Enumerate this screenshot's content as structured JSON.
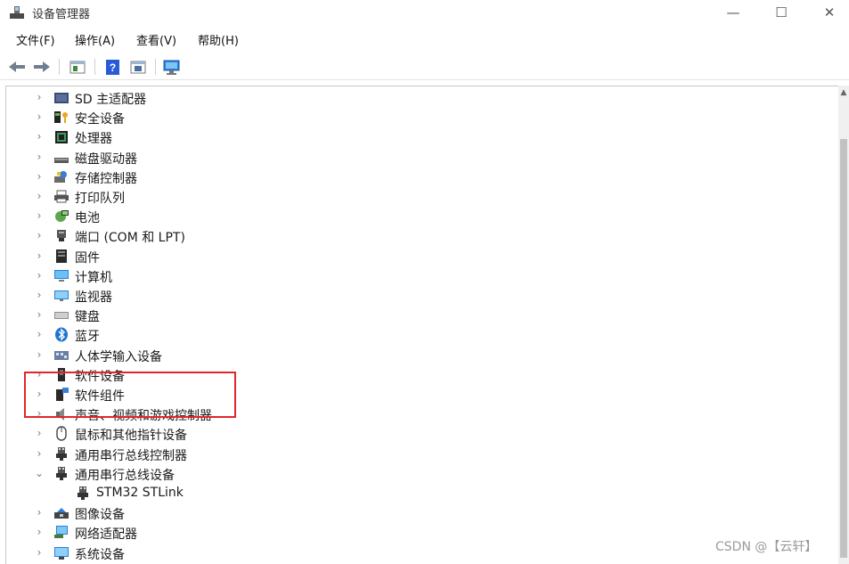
{
  "window": {
    "title": "设备管理器",
    "minimize": "—",
    "maximize": "☐",
    "close": "✕"
  },
  "menu": [
    "文件(F)",
    "操作(A)",
    "查看(V)",
    "帮助(H)"
  ],
  "tree": {
    "items": [
      {
        "label": "SD 主适配器",
        "icon": "sd-card-icon"
      },
      {
        "label": "安全设备",
        "icon": "security-key-icon"
      },
      {
        "label": "处理器",
        "icon": "processor-icon"
      },
      {
        "label": "磁盘驱动器",
        "icon": "disk-drive-icon"
      },
      {
        "label": "存储控制器",
        "icon": "storage-controller-icon"
      },
      {
        "label": "打印队列",
        "icon": "printer-icon"
      },
      {
        "label": "电池",
        "icon": "battery-icon"
      },
      {
        "label": "端口 (COM 和 LPT)",
        "icon": "port-icon"
      },
      {
        "label": "固件",
        "icon": "firmware-icon"
      },
      {
        "label": "计算机",
        "icon": "computer-icon"
      },
      {
        "label": "监视器",
        "icon": "monitor-icon"
      },
      {
        "label": "键盘",
        "icon": "keyboard-icon"
      },
      {
        "label": "蓝牙",
        "icon": "bluetooth-icon"
      },
      {
        "label": "人体学输入设备",
        "icon": "hid-icon"
      },
      {
        "label": "软件设备",
        "icon": "software-device-icon"
      },
      {
        "label": "软件组件",
        "icon": "software-component-icon"
      },
      {
        "label": "声音、视频和游戏控制器",
        "icon": "speaker-icon"
      },
      {
        "label": "鼠标和其他指针设备",
        "icon": "mouse-icon"
      },
      {
        "label": "通用串行总线控制器",
        "icon": "usb-icon"
      },
      {
        "label": "通用串行总线设备",
        "icon": "usb-icon",
        "expanded": true
      },
      {
        "label": "STM32 STLink",
        "icon": "usb-icon",
        "child": true
      },
      {
        "label": "图像设备",
        "icon": "camera-icon"
      },
      {
        "label": "网络适配器",
        "icon": "network-adapter-icon"
      },
      {
        "label": "系统设备",
        "icon": "system-device-icon"
      }
    ]
  },
  "chevrons": {
    "collapsed": "›",
    "expanded": "⌄"
  },
  "scroll_up": "▲",
  "watermark": "CSDN @【云轩】",
  "colors": {
    "highlight": "#e0262b"
  }
}
